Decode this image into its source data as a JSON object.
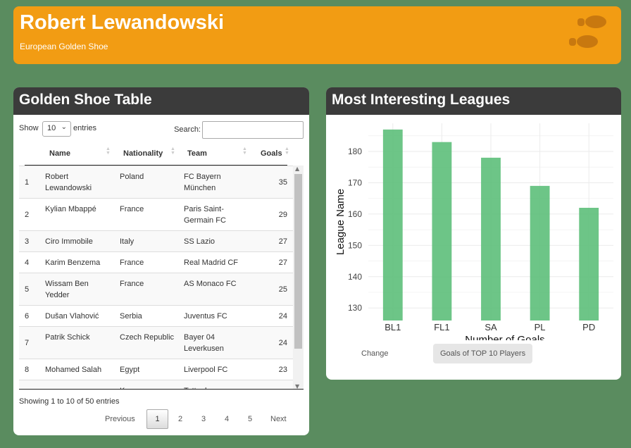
{
  "header": {
    "title": "Robert Lewandowski",
    "subtitle": "European Golden Shoe",
    "icon": "footprint-icon",
    "color": "#f29c13"
  },
  "table_card": {
    "title": "Golden Shoe Table",
    "show_label": "Show",
    "entries_value": "10",
    "entries_label": "entries",
    "search_label": "Search:",
    "search_value": "",
    "columns": [
      "",
      "Name",
      "Nationality",
      "Team",
      "Goals"
    ],
    "rows": [
      {
        "rank": "1",
        "name": "Robert Lewandowski",
        "nationality": "Poland",
        "team": "FC Bayern München",
        "goals": "35"
      },
      {
        "rank": "2",
        "name": "Kylian Mbappé",
        "nationality": "France",
        "team": "Paris Saint-Germain FC",
        "goals": "29"
      },
      {
        "rank": "3",
        "name": "Ciro Immobile",
        "nationality": "Italy",
        "team": "SS Lazio",
        "goals": "27"
      },
      {
        "rank": "4",
        "name": "Karim Benzema",
        "nationality": "France",
        "team": "Real Madrid CF",
        "goals": "27"
      },
      {
        "rank": "5",
        "name": "Wissam Ben Yedder",
        "nationality": "France",
        "team": "AS Monaco FC",
        "goals": "25"
      },
      {
        "rank": "6",
        "name": "Dušan Vlahović",
        "nationality": "Serbia",
        "team": "Juventus FC",
        "goals": "24"
      },
      {
        "rank": "7",
        "name": "Patrik Schick",
        "nationality": "Czech Republic",
        "team": "Bayer 04 Leverkusen",
        "goals": "24"
      },
      {
        "rank": "8",
        "name": "Mohamed Salah",
        "nationality": "Egypt",
        "team": "Liverpool FC",
        "goals": "23"
      },
      {
        "rank": "",
        "name": "",
        "nationality": "Korea",
        "team": "Tottenham",
        "goals": ""
      }
    ],
    "info": "Showing 1 to 10 of 50 entries",
    "pagination": {
      "previous": "Previous",
      "pages": [
        "1",
        "2",
        "3",
        "4",
        "5"
      ],
      "active": "1",
      "next": "Next"
    }
  },
  "chart_card": {
    "title": "Most Interesting Leagues",
    "tabs": [
      {
        "label": "Change",
        "active": false
      },
      {
        "label": "Goals of TOP 10 Players",
        "active": true
      }
    ]
  },
  "chart_data": {
    "type": "bar",
    "categories": [
      "BL1",
      "FL1",
      "SA",
      "PL",
      "PD"
    ],
    "values": [
      187,
      183,
      178,
      169,
      162
    ],
    "xlabel": "Number of Goals",
    "ylabel": "League Name",
    "ylim": [
      126,
      189
    ],
    "yticks": [
      130,
      140,
      150,
      160,
      170,
      180
    ],
    "bar_color": "#5dbf7a",
    "grid": true
  }
}
